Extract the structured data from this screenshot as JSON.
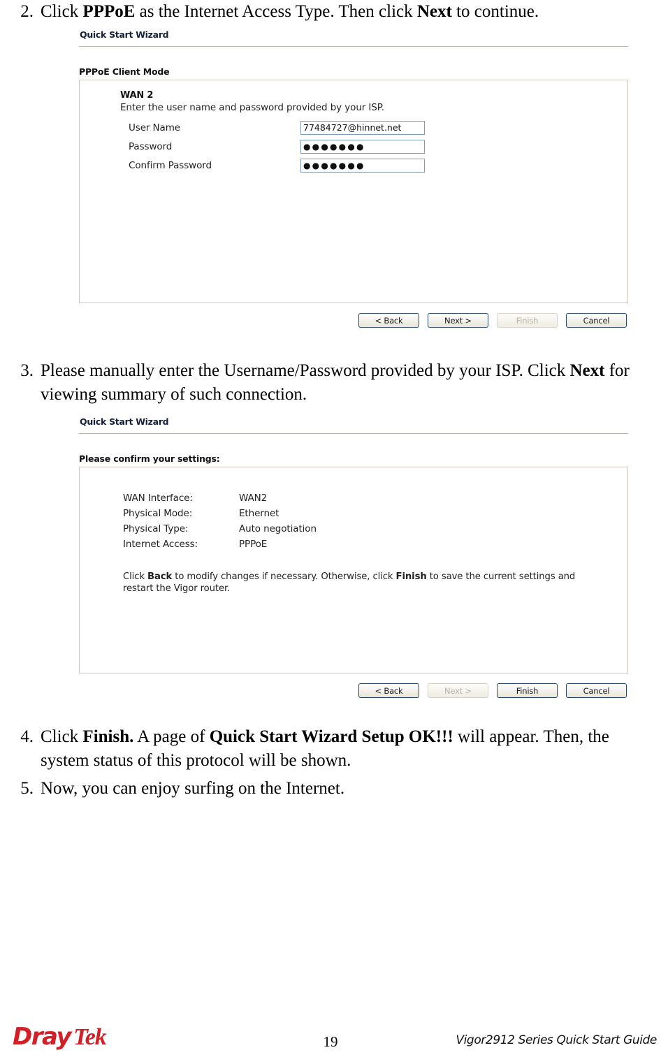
{
  "page": {
    "number": "19",
    "footer_guide": "Vigor2912 Series Quick Start Guide",
    "logo_dray": "Dray",
    "logo_tek": "Tek",
    "logo_color": "#d12027"
  },
  "steps": [
    {
      "number": "2.",
      "parts": [
        {
          "text": "Click ",
          "bold": false
        },
        {
          "text": "PPPoE",
          "bold": true
        },
        {
          "text": " as the Internet Access Type. Then click ",
          "bold": false
        },
        {
          "text": "Next",
          "bold": true
        },
        {
          "text": " to continue.",
          "bold": false
        }
      ]
    },
    {
      "number": "3.",
      "parts": [
        {
          "text": "Please manually enter the Username/Password provided by your ISP. Click ",
          "bold": false
        },
        {
          "text": "Next",
          "bold": true
        },
        {
          "text": " for viewing summary of such connection.",
          "bold": false
        }
      ]
    },
    {
      "number": "4.",
      "parts": [
        {
          "text": "Click ",
          "bold": false
        },
        {
          "text": "Finish.",
          "bold": true
        },
        {
          "text": " A page of ",
          "bold": false
        },
        {
          "text": "Quick Start Wizard Setup OK!!!",
          "bold": true
        },
        {
          "text": " will appear. Then, the system status of this protocol will be shown.",
          "bold": false
        }
      ]
    },
    {
      "number": "5.",
      "parts": [
        {
          "text": "Now, you can enjoy surfing on the Internet.",
          "bold": false
        }
      ]
    }
  ],
  "wizard1": {
    "title": "Quick Start Wizard",
    "section_label": "PPPoE Client Mode",
    "wan_label": "WAN 2",
    "wan_hint": "Enter the user name and password provided by your ISP.",
    "fields": [
      {
        "label": "User Name",
        "value": "77484727@hinnet.net",
        "masked": false
      },
      {
        "label": "Password",
        "value": "●●●●●●●",
        "masked": true
      },
      {
        "label": "Confirm Password",
        "value": "●●●●●●●",
        "masked": true
      }
    ],
    "buttons": [
      {
        "label": "< Back",
        "disabled": false
      },
      {
        "label": "Next >",
        "disabled": false
      },
      {
        "label": "Finish",
        "disabled": true
      },
      {
        "label": "Cancel",
        "disabled": false
      }
    ]
  },
  "wizard2": {
    "title": "Quick Start Wizard",
    "section_label": "Please confirm your settings:",
    "summary": [
      {
        "key": "WAN Interface:",
        "value": "WAN2"
      },
      {
        "key": "Physical Mode:",
        "value": "Ethernet"
      },
      {
        "key": "Physical Type:",
        "value": "Auto negotiation"
      },
      {
        "key": "Internet Access:",
        "value": "PPPoE"
      }
    ],
    "note_parts": [
      {
        "text": "Click ",
        "bold": false
      },
      {
        "text": "Back",
        "bold": true
      },
      {
        "text": "  to modify changes if necessary. Otherwise, click ",
        "bold": false
      },
      {
        "text": "Finish",
        "bold": true
      },
      {
        "text": "  to save the current settings and restart the Vigor router.",
        "bold": false
      }
    ],
    "buttons": [
      {
        "label": "< Back",
        "disabled": false
      },
      {
        "label": "Next >",
        "disabled": true
      },
      {
        "label": "Finish",
        "disabled": false
      },
      {
        "label": "Cancel",
        "disabled": false
      }
    ]
  }
}
